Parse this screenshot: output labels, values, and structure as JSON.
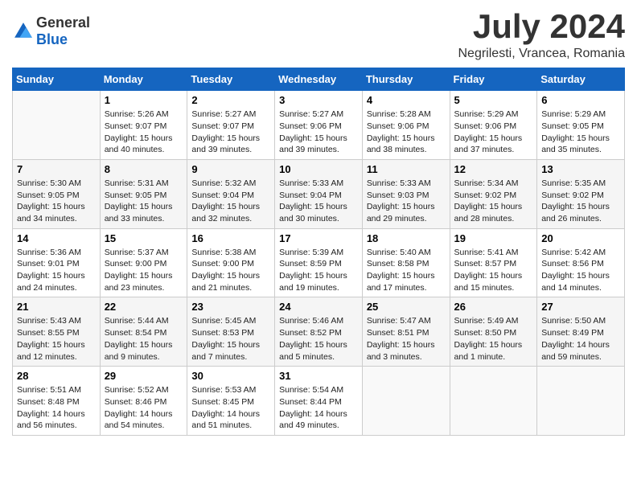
{
  "header": {
    "logo_general": "General",
    "logo_blue": "Blue",
    "month_title": "July 2024",
    "location": "Negrilesti, Vrancea, Romania"
  },
  "weekdays": [
    "Sunday",
    "Monday",
    "Tuesday",
    "Wednesday",
    "Thursday",
    "Friday",
    "Saturday"
  ],
  "weeks": [
    [
      {
        "day": "",
        "info": ""
      },
      {
        "day": "1",
        "info": "Sunrise: 5:26 AM\nSunset: 9:07 PM\nDaylight: 15 hours\nand 40 minutes."
      },
      {
        "day": "2",
        "info": "Sunrise: 5:27 AM\nSunset: 9:07 PM\nDaylight: 15 hours\nand 39 minutes."
      },
      {
        "day": "3",
        "info": "Sunrise: 5:27 AM\nSunset: 9:06 PM\nDaylight: 15 hours\nand 39 minutes."
      },
      {
        "day": "4",
        "info": "Sunrise: 5:28 AM\nSunset: 9:06 PM\nDaylight: 15 hours\nand 38 minutes."
      },
      {
        "day": "5",
        "info": "Sunrise: 5:29 AM\nSunset: 9:06 PM\nDaylight: 15 hours\nand 37 minutes."
      },
      {
        "day": "6",
        "info": "Sunrise: 5:29 AM\nSunset: 9:05 PM\nDaylight: 15 hours\nand 35 minutes."
      }
    ],
    [
      {
        "day": "7",
        "info": "Sunrise: 5:30 AM\nSunset: 9:05 PM\nDaylight: 15 hours\nand 34 minutes."
      },
      {
        "day": "8",
        "info": "Sunrise: 5:31 AM\nSunset: 9:05 PM\nDaylight: 15 hours\nand 33 minutes."
      },
      {
        "day": "9",
        "info": "Sunrise: 5:32 AM\nSunset: 9:04 PM\nDaylight: 15 hours\nand 32 minutes."
      },
      {
        "day": "10",
        "info": "Sunrise: 5:33 AM\nSunset: 9:04 PM\nDaylight: 15 hours\nand 30 minutes."
      },
      {
        "day": "11",
        "info": "Sunrise: 5:33 AM\nSunset: 9:03 PM\nDaylight: 15 hours\nand 29 minutes."
      },
      {
        "day": "12",
        "info": "Sunrise: 5:34 AM\nSunset: 9:02 PM\nDaylight: 15 hours\nand 28 minutes."
      },
      {
        "day": "13",
        "info": "Sunrise: 5:35 AM\nSunset: 9:02 PM\nDaylight: 15 hours\nand 26 minutes."
      }
    ],
    [
      {
        "day": "14",
        "info": "Sunrise: 5:36 AM\nSunset: 9:01 PM\nDaylight: 15 hours\nand 24 minutes."
      },
      {
        "day": "15",
        "info": "Sunrise: 5:37 AM\nSunset: 9:00 PM\nDaylight: 15 hours\nand 23 minutes."
      },
      {
        "day": "16",
        "info": "Sunrise: 5:38 AM\nSunset: 9:00 PM\nDaylight: 15 hours\nand 21 minutes."
      },
      {
        "day": "17",
        "info": "Sunrise: 5:39 AM\nSunset: 8:59 PM\nDaylight: 15 hours\nand 19 minutes."
      },
      {
        "day": "18",
        "info": "Sunrise: 5:40 AM\nSunset: 8:58 PM\nDaylight: 15 hours\nand 17 minutes."
      },
      {
        "day": "19",
        "info": "Sunrise: 5:41 AM\nSunset: 8:57 PM\nDaylight: 15 hours\nand 15 minutes."
      },
      {
        "day": "20",
        "info": "Sunrise: 5:42 AM\nSunset: 8:56 PM\nDaylight: 15 hours\nand 14 minutes."
      }
    ],
    [
      {
        "day": "21",
        "info": "Sunrise: 5:43 AM\nSunset: 8:55 PM\nDaylight: 15 hours\nand 12 minutes."
      },
      {
        "day": "22",
        "info": "Sunrise: 5:44 AM\nSunset: 8:54 PM\nDaylight: 15 hours\nand 9 minutes."
      },
      {
        "day": "23",
        "info": "Sunrise: 5:45 AM\nSunset: 8:53 PM\nDaylight: 15 hours\nand 7 minutes."
      },
      {
        "day": "24",
        "info": "Sunrise: 5:46 AM\nSunset: 8:52 PM\nDaylight: 15 hours\nand 5 minutes."
      },
      {
        "day": "25",
        "info": "Sunrise: 5:47 AM\nSunset: 8:51 PM\nDaylight: 15 hours\nand 3 minutes."
      },
      {
        "day": "26",
        "info": "Sunrise: 5:49 AM\nSunset: 8:50 PM\nDaylight: 15 hours\nand 1 minute."
      },
      {
        "day": "27",
        "info": "Sunrise: 5:50 AM\nSunset: 8:49 PM\nDaylight: 14 hours\nand 59 minutes."
      }
    ],
    [
      {
        "day": "28",
        "info": "Sunrise: 5:51 AM\nSunset: 8:48 PM\nDaylight: 14 hours\nand 56 minutes."
      },
      {
        "day": "29",
        "info": "Sunrise: 5:52 AM\nSunset: 8:46 PM\nDaylight: 14 hours\nand 54 minutes."
      },
      {
        "day": "30",
        "info": "Sunrise: 5:53 AM\nSunset: 8:45 PM\nDaylight: 14 hours\nand 51 minutes."
      },
      {
        "day": "31",
        "info": "Sunrise: 5:54 AM\nSunset: 8:44 PM\nDaylight: 14 hours\nand 49 minutes."
      },
      {
        "day": "",
        "info": ""
      },
      {
        "day": "",
        "info": ""
      },
      {
        "day": "",
        "info": ""
      }
    ]
  ]
}
